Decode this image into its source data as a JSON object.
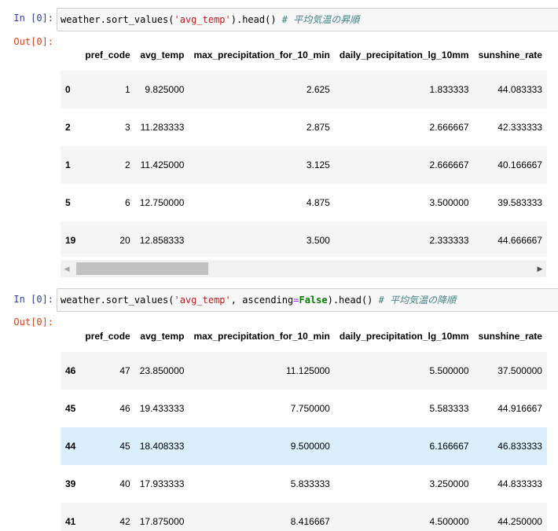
{
  "cells": [
    {
      "in_prompt": "In [0]:",
      "out_prompt": "Out[0]:",
      "code": {
        "p1": "weather.sort_values(",
        "str": "'avg_temp'",
        "p2": ").head() ",
        "comment": "# 平均気温の昇順"
      },
      "table": {
        "columns": [
          "",
          "pref_code",
          "avg_temp",
          "max_precipitation_for_10_min",
          "daily_precipitation_lg_10mm",
          "sunshine_rate"
        ],
        "rows": [
          {
            "index": "0",
            "pref_code": "1",
            "avg_temp": "9.825000",
            "max_precip": "2.625",
            "daily_precip": "1.833333",
            "sunshine": "44.083333"
          },
          {
            "index": "2",
            "pref_code": "3",
            "avg_temp": "11.283333",
            "max_precip": "2.875",
            "daily_precip": "2.666667",
            "sunshine": "42.333333"
          },
          {
            "index": "1",
            "pref_code": "2",
            "avg_temp": "11.425000",
            "max_precip": "3.125",
            "daily_precip": "2.666667",
            "sunshine": "40.166667"
          },
          {
            "index": "5",
            "pref_code": "6",
            "avg_temp": "12.750000",
            "max_precip": "4.875",
            "daily_precip": "3.500000",
            "sunshine": "39.583333"
          },
          {
            "index": "19",
            "pref_code": "20",
            "avg_temp": "12.858333",
            "max_precip": "3.500",
            "daily_precip": "2.333333",
            "sunshine": "44.666667"
          }
        ]
      }
    },
    {
      "in_prompt": "In [0]:",
      "out_prompt": "Out[0]:",
      "code": {
        "p1": "weather.sort_values(",
        "str": "'avg_temp'",
        "p2": ", ascending",
        "op": "=",
        "kw": "False",
        "p3": ").head() ",
        "comment": "# 平均気温の降順"
      },
      "table": {
        "columns": [
          "",
          "pref_code",
          "avg_temp",
          "max_precipitation_for_10_min",
          "daily_precipitation_lg_10mm",
          "sunshine_rate"
        ],
        "rows": [
          {
            "index": "46",
            "pref_code": "47",
            "avg_temp": "23.850000",
            "max_precip": "11.125000",
            "daily_precip": "5.500000",
            "sunshine": "37.500000"
          },
          {
            "index": "45",
            "pref_code": "46",
            "avg_temp": "19.433333",
            "max_precip": "7.750000",
            "daily_precip": "5.583333",
            "sunshine": "44.916667"
          },
          {
            "index": "44",
            "pref_code": "45",
            "avg_temp": "18.408333",
            "max_precip": "9.500000",
            "daily_precip": "6.166667",
            "sunshine": "46.833333"
          },
          {
            "index": "39",
            "pref_code": "40",
            "avg_temp": "17.933333",
            "max_precip": "5.833333",
            "daily_precip": "3.250000",
            "sunshine": "44.833333"
          },
          {
            "index": "41",
            "pref_code": "42",
            "avg_temp": "17.875000",
            "max_precip": "8.416667",
            "daily_precip": "4.500000",
            "sunshine": "44.250000"
          }
        ]
      }
    }
  ],
  "scrollbar": {
    "left_arrow": "◀",
    "right_arrow": "▶"
  },
  "colors": {
    "prompt_in": "#303f9f",
    "prompt_out": "#d84315",
    "hover_row": "#daeefb"
  }
}
